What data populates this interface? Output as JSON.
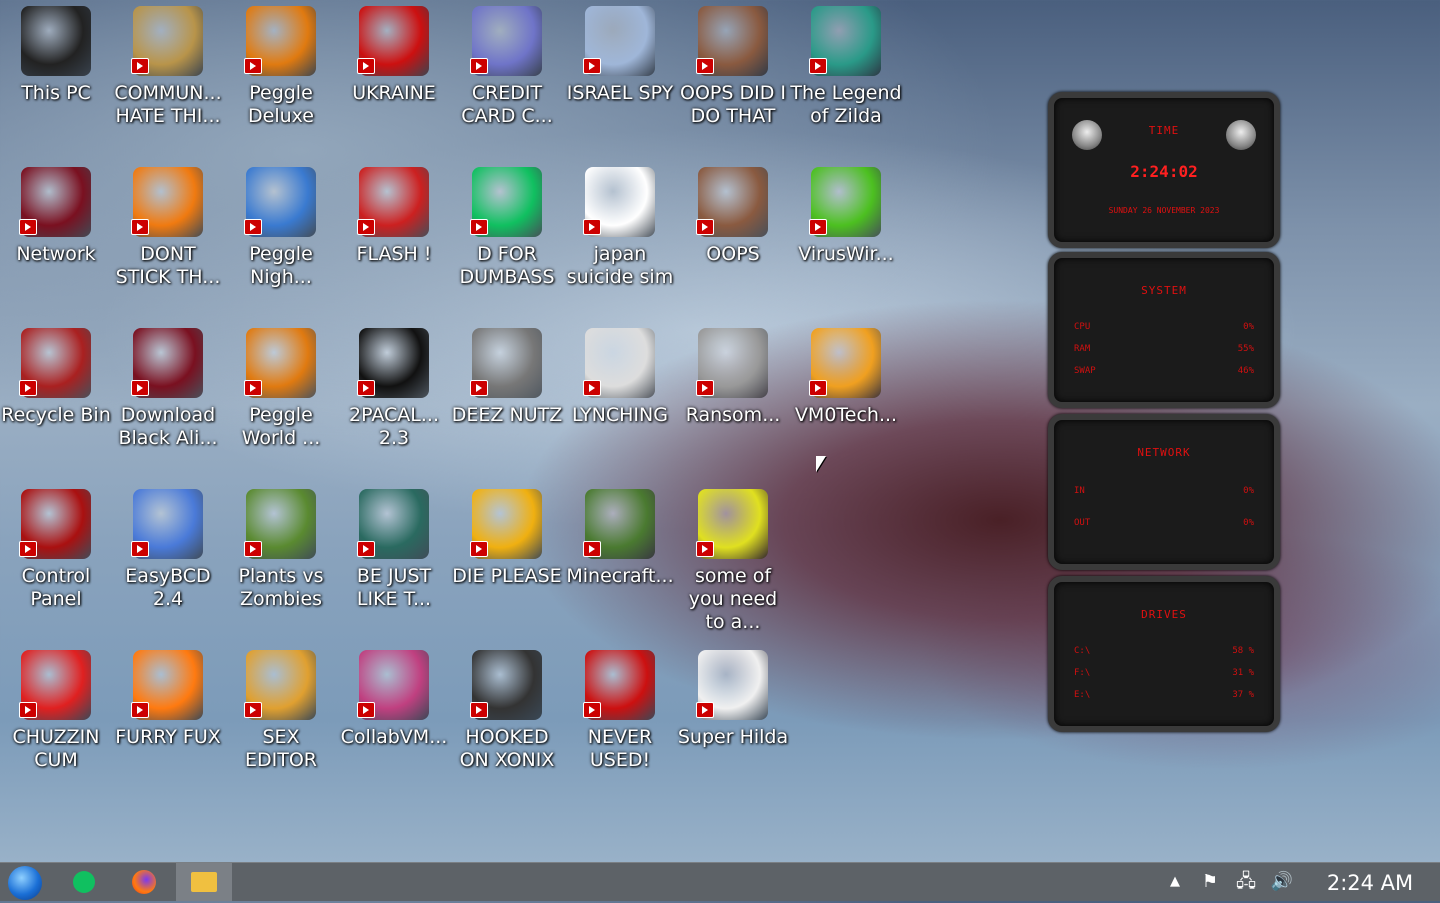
{
  "desktop": {
    "icons": [
      {
        "label": "This PC",
        "icon": "monitor-icon",
        "color": "#222222"
      },
      {
        "label": "COMMUN... HATE THI...",
        "icon": "money-bag-icon",
        "color": "#b8944a"
      },
      {
        "label": "Peggle Deluxe",
        "icon": "peggle-icon",
        "color": "#e07a10"
      },
      {
        "label": "UKRAINE",
        "icon": "radiation-icon",
        "color": "#cc1010"
      },
      {
        "label": "CREDIT CARD C...",
        "icon": "credit-card-icon",
        "color": "#6f74c8"
      },
      {
        "label": "ISRAEL SPY",
        "icon": "spy-search-icon",
        "color": "#9fb6d8"
      },
      {
        "label": "OOPS DID I DO THAT",
        "icon": "portrait-icon",
        "color": "#8a5a40"
      },
      {
        "label": "The Legend of Zilda",
        "icon": "pixel-character-icon",
        "color": "#2a9a88"
      },
      {
        "label": "Network",
        "icon": "network-orb-icon",
        "color": "#7a1020"
      },
      {
        "label": "DONT STICK TH...",
        "icon": "traffic-cone-icon",
        "color": "#f07a10"
      },
      {
        "label": "Peggle Nigh...",
        "icon": "peggle-night-icon",
        "color": "#3a7ad0"
      },
      {
        "label": "FLASH !",
        "icon": "flash-icon",
        "color": "#cc2020"
      },
      {
        "label": "D FOR DUMBASS",
        "icon": "chat-document-icon",
        "color": "#10c060"
      },
      {
        "label": "japan suicide sim",
        "icon": "game-cover-icon",
        "color": "#ffffff"
      },
      {
        "label": "OOPS",
        "icon": "portrait-64-icon",
        "color": "#8a5a40"
      },
      {
        "label": "VirusWir...",
        "icon": "lime-icon",
        "color": "#4cc020"
      },
      {
        "label": "Recycle Bin",
        "icon": "recycle-bin-icon",
        "color": "#aa2020"
      },
      {
        "label": "Download Black Ali...",
        "icon": "alien-orb-icon",
        "color": "#7a1020"
      },
      {
        "label": "Peggle World ...",
        "icon": "peggle-world-icon",
        "color": "#e07a10"
      },
      {
        "label": "2PACAL... 2.3",
        "icon": "terminal-icon",
        "color": "#111111"
      },
      {
        "label": "DEEZ NUTZ",
        "icon": "windows-stack-icon",
        "color": "#777777"
      },
      {
        "label": "LYNCHING",
        "icon": "rope-icon",
        "color": "#dddddd"
      },
      {
        "label": "Ransom...",
        "icon": "skull-icon",
        "color": "#999999"
      },
      {
        "label": "VM0Tech...",
        "icon": "doctor-icon",
        "color": "#f0a020"
      },
      {
        "label": "Control Panel",
        "icon": "control-panel-icon",
        "color": "#aa1010"
      },
      {
        "label": "EasyBCD 2.4",
        "icon": "computer-setup-icon",
        "color": "#4a7ad8"
      },
      {
        "label": "Plants vs Zombies",
        "icon": "plant-icon",
        "color": "#5a8a30"
      },
      {
        "label": "BE JUST LIKE T...",
        "icon": "santa-icon",
        "color": "#2a6a60"
      },
      {
        "label": "DIE PLEASE",
        "icon": "de-logo-icon",
        "color": "#f0b010"
      },
      {
        "label": "Minecraft...",
        "icon": "grass-block-icon",
        "color": "#4a7a30"
      },
      {
        "label": "some of you need to a...",
        "icon": "cartoon-dog-icon",
        "color": "#e0e020"
      },
      {
        "label": "CHUZZIN CUM",
        "icon": "chuzzle-icon",
        "color": "#e02020"
      },
      {
        "label": "FURRY FUX",
        "icon": "firefox-icon",
        "color": "#ff7a10"
      },
      {
        "label": "SEX EDITOR",
        "icon": "hxd-icon",
        "color": "#e0a030"
      },
      {
        "label": "CollabVM...",
        "icon": "monitor-pink-icon",
        "color": "#c04080"
      },
      {
        "label": "HOOKED ON XONIX",
        "icon": "xonix-icon",
        "color": "#333333"
      },
      {
        "label": "NEVER USED!",
        "icon": "devcpp-icon",
        "color": "#cc1010"
      },
      {
        "label": "Super Hilda",
        "icon": "pixel-dog-icon",
        "color": "#f0f0f0"
      }
    ]
  },
  "gadget": {
    "time": {
      "title": "TIME",
      "clock": "2:24:02",
      "date": "SUNDAY 26 NOVEMBER 2023"
    },
    "system": {
      "title": "SYSTEM",
      "rows": [
        {
          "label": "CPU",
          "value": "0%"
        },
        {
          "label": "RAM",
          "value": "55%"
        },
        {
          "label": "SWAP",
          "value": "46%"
        }
      ]
    },
    "network": {
      "title": "NETWORK",
      "rows": [
        {
          "label": "IN",
          "value": "0%"
        },
        {
          "label": "OUT",
          "value": "0%"
        }
      ]
    },
    "drives": {
      "title": "DRIVES",
      "rows": [
        {
          "label": "C:\\",
          "value": "58 %"
        },
        {
          "label": "F:\\",
          "value": "31 %"
        },
        {
          "label": "E:\\",
          "value": "37 %"
        }
      ]
    }
  },
  "taskbar": {
    "apps": [
      {
        "icon": "start-orb-icon"
      },
      {
        "icon": "chat-app-icon",
        "color": "#10c060"
      },
      {
        "icon": "firefox-icon",
        "color": "#ff7a10"
      },
      {
        "icon": "file-explorer-icon",
        "color": "#f0c040",
        "active": true
      }
    ],
    "tray": [
      "show-hidden-icons-chevron",
      "action-center-flag-icon",
      "network-icon",
      "volume-icon"
    ],
    "time": "2:24 AM"
  }
}
